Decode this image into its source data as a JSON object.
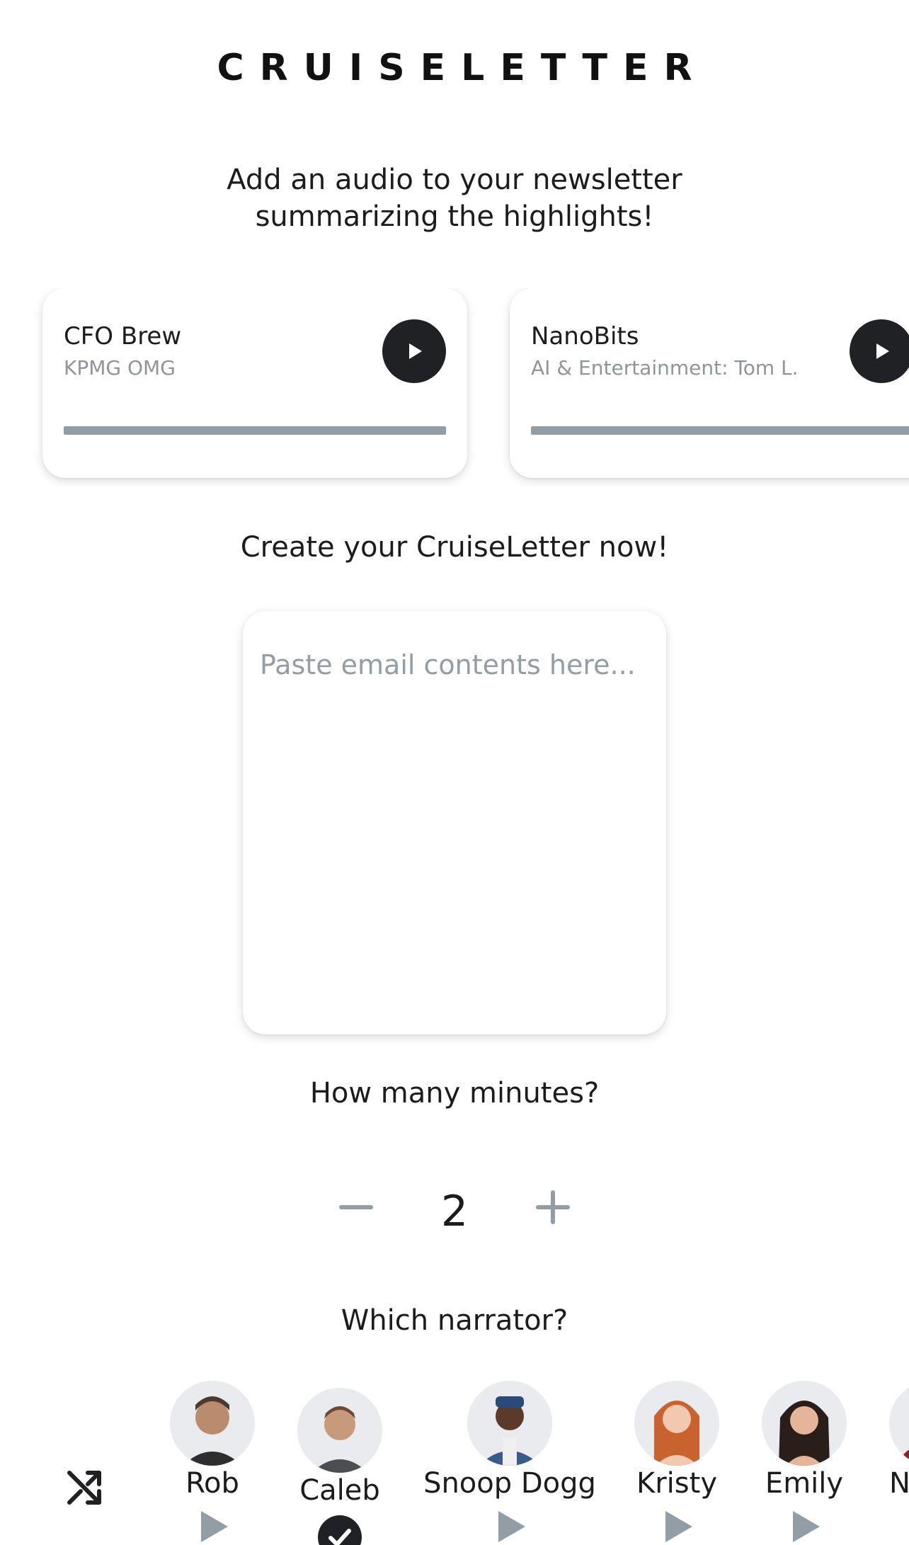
{
  "app": {
    "logo_text": "CRUISELETTER"
  },
  "intro": {
    "subtitle_line1": "Add an audio to your newsletter",
    "subtitle_line2": "summarizing the highlights!"
  },
  "samples": [
    {
      "title": "CFO Brew",
      "subtitle": "KPMG OMG",
      "progress": 0
    },
    {
      "title": "NanoBits",
      "subtitle": "AI & Entertainment: Tom L...",
      "progress": 0
    }
  ],
  "create": {
    "heading": "Create your CruiseLetter now!",
    "placeholder": "Paste email contents here..."
  },
  "duration": {
    "question": "How many minutes?",
    "value": "2"
  },
  "narrator_section": {
    "question": "Which narrator?",
    "selected": "Caleb",
    "narrators": [
      {
        "name": "Rob"
      },
      {
        "name": "Caleb"
      },
      {
        "name": "Snoop Dogg"
      },
      {
        "name": "Kristy"
      },
      {
        "name": "Emily"
      },
      {
        "name": "N"
      }
    ]
  },
  "colors": {
    "dark": "#1f2124",
    "muted": "#939da6",
    "background": "#ffffff"
  }
}
